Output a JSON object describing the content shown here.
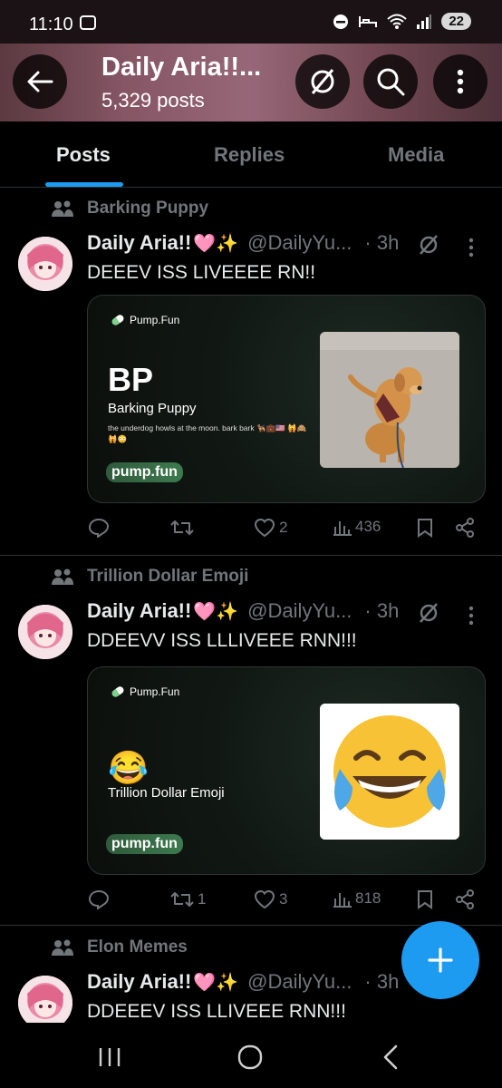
{
  "status_bar": {
    "time": "11:10",
    "battery": "22"
  },
  "header": {
    "title": "Daily Aria!!...",
    "subtitle": "5,329 posts"
  },
  "tabs": [
    {
      "label": "Posts",
      "active": true
    },
    {
      "label": "Replies",
      "active": false
    },
    {
      "label": "Media",
      "active": false
    }
  ],
  "posts": [
    {
      "community": "Barking Puppy",
      "author": "Daily Aria!!",
      "author_emoji": "🩷✨",
      "handle": "@DailyYu...",
      "time": "· 3h",
      "text": "DEEEV ISS LIVEEEE RN!!",
      "card": {
        "brand": "Pump.Fun",
        "ticker": "BP",
        "name": "Barking Puppy",
        "description": "the underdog howls at the moon. bark bark 🐕‍🦺💼🇺🇸 🙀🙈🙀😳",
        "cta": "pump.fun"
      },
      "stats": {
        "replies": "",
        "reposts": "",
        "likes": "2",
        "views": "436"
      }
    },
    {
      "community": "Trillion Dollar Emoji",
      "author": "Daily Aria!!",
      "author_emoji": "🩷✨",
      "handle": "@DailyYu...",
      "time": "· 3h",
      "text": "DDEEVV ISS LLLIVEEE RNN!!!",
      "card": {
        "brand": "Pump.Fun",
        "emoji": "😂",
        "name": "Trillion Dollar Emoji",
        "cta": "pump.fun"
      },
      "stats": {
        "replies": "",
        "reposts": "1",
        "likes": "3",
        "views": "818"
      }
    },
    {
      "community": "Elon Memes",
      "author": "Daily Aria!!",
      "author_emoji": "🩷✨",
      "handle": "@DailyYu...",
      "time": "· 3h",
      "text": "DDEEEV ISS LLIVEEE RNN!!!"
    }
  ],
  "colors": {
    "accent": "#1d9bf0",
    "background": "#000000",
    "secondary_text": "#71767b"
  }
}
